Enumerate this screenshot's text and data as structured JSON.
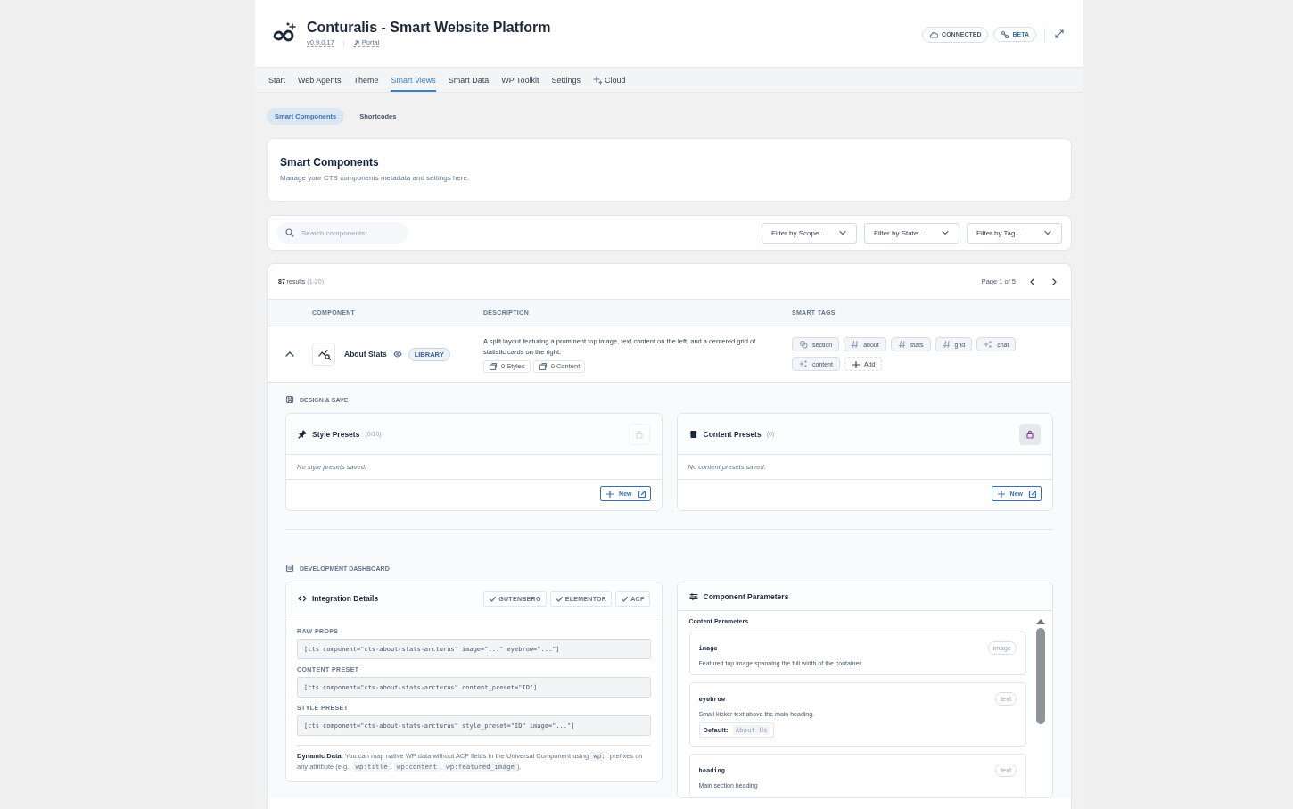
{
  "header": {
    "title": "Conturalis - Smart Website Platform",
    "version": "v0.9.0.17",
    "portal": "Portal",
    "badges": [
      {
        "label": "CONNECTED",
        "kind": "cloud"
      },
      {
        "label": "BETA",
        "kind": "beta"
      }
    ]
  },
  "tabs": [
    {
      "label": "Start",
      "selected": false,
      "kind": "plain"
    },
    {
      "label": "Web Agents",
      "selected": false,
      "kind": "plain"
    },
    {
      "label": "Theme",
      "selected": false,
      "kind": "plain"
    },
    {
      "label": "Smart Views",
      "selected": true,
      "kind": "plain"
    },
    {
      "label": "Smart Data",
      "selected": false,
      "kind": "plain"
    },
    {
      "label": "WP Toolkit",
      "selected": false,
      "kind": "plain"
    },
    {
      "label": "Settings",
      "selected": false,
      "kind": "plain"
    },
    {
      "label": "Cloud",
      "selected": false,
      "kind": "sparkle"
    }
  ],
  "subtabs": [
    {
      "label": "Smart Components",
      "selected": true
    },
    {
      "label": "Shortcodes",
      "selected": false
    }
  ],
  "page_header": {
    "title": "Smart Components",
    "subtitle": "Manage your CTS components metadata and settings here."
  },
  "filters": {
    "search": {
      "placeholder": "Search components..."
    },
    "dropdowns": [
      "Filter by Scope...",
      "Filter by State...",
      "Filter by Tag..."
    ]
  },
  "results": {
    "count": "87",
    "label": "results",
    "range": "(1-20)",
    "page": "Page 1 of 5"
  },
  "table": {
    "columns": [
      "COMPONENT",
      "DESCRIPTION",
      "SMART TAGS"
    ],
    "rows": [
      {
        "name": "About Stats",
        "expanded": true,
        "badge": "LIBRARY",
        "description": "A split layout featuring a prominent top image, text content on the left, and a centered grid of statistic cards on the right.",
        "stats": [
          "0 Styles",
          "0 Content"
        ],
        "tags": [
          {
            "label": "section",
            "kind": "layers"
          },
          {
            "label": "about",
            "kind": "hash"
          },
          {
            "label": "stats",
            "kind": "hash"
          },
          {
            "label": "grid",
            "kind": "hash"
          },
          {
            "label": "chat",
            "kind": "ai"
          },
          {
            "label": "content",
            "kind": "ai"
          }
        ],
        "add": "Add"
      }
    ]
  },
  "design": {
    "title": "DESIGN & SAVE",
    "cards": [
      {
        "title": "Style Presets",
        "count": "(0/10)",
        "kind": "style",
        "empty": "No style presets saved.",
        "new": "New",
        "lock_active": false
      },
      {
        "title": "Content Presets",
        "count": "(0)",
        "kind": "content",
        "empty": "No content presets saved.",
        "new": "New",
        "lock_active": true
      }
    ]
  },
  "dev": {
    "title": "DEVELOPMENT DASHBOARD",
    "integration": {
      "title": "Integration Details",
      "badges": [
        "GUTENBERG",
        "ELEMENTOR",
        "ACF"
      ],
      "fields": [
        {
          "label": "RAW PROPS",
          "value": "[cts component=\"cts-about-stats-arcturus\" image=\"...\" eyebrow=\"...\"]"
        },
        {
          "label": "CONTENT PRESET",
          "value": "[cts component=\"cts-about-stats-arcturus\" content_preset=\"ID\"]"
        },
        {
          "label": "STYLE PRESET",
          "value": "[cts component=\"cts-about-stats-arcturus\" style_preset=\"ID\" image=\"...\"]"
        }
      ],
      "note": [
        {
          "kind": "bold",
          "text": "Dynamic Data:"
        },
        {
          "kind": "text",
          "text": " You can map native WP data without ACF fields in the Universal Component using "
        },
        {
          "kind": "code",
          "text": "wp:"
        },
        {
          "kind": "text",
          "text": " prefixes on any attribute (e.g., "
        },
        {
          "kind": "code",
          "text": "wp:title"
        },
        {
          "kind": "text",
          "text": ", "
        },
        {
          "kind": "code",
          "text": "wp:content"
        },
        {
          "kind": "text",
          "text": ", "
        },
        {
          "kind": "code",
          "text": "wp:featured_image"
        },
        {
          "kind": "text",
          "text": ")."
        }
      ]
    },
    "params": {
      "title": "Component Parameters",
      "section": "Content Parameters",
      "items": [
        {
          "name": "image",
          "type": "image",
          "description": "Featured top image spanning the full width of the container."
        },
        {
          "name": "eyebrow",
          "type": "text",
          "description": "Small kicker text above the main heading.",
          "default_label": "Default:",
          "default": "About Us"
        },
        {
          "name": "heading",
          "type": "text",
          "description": "Main section heading"
        }
      ]
    }
  }
}
